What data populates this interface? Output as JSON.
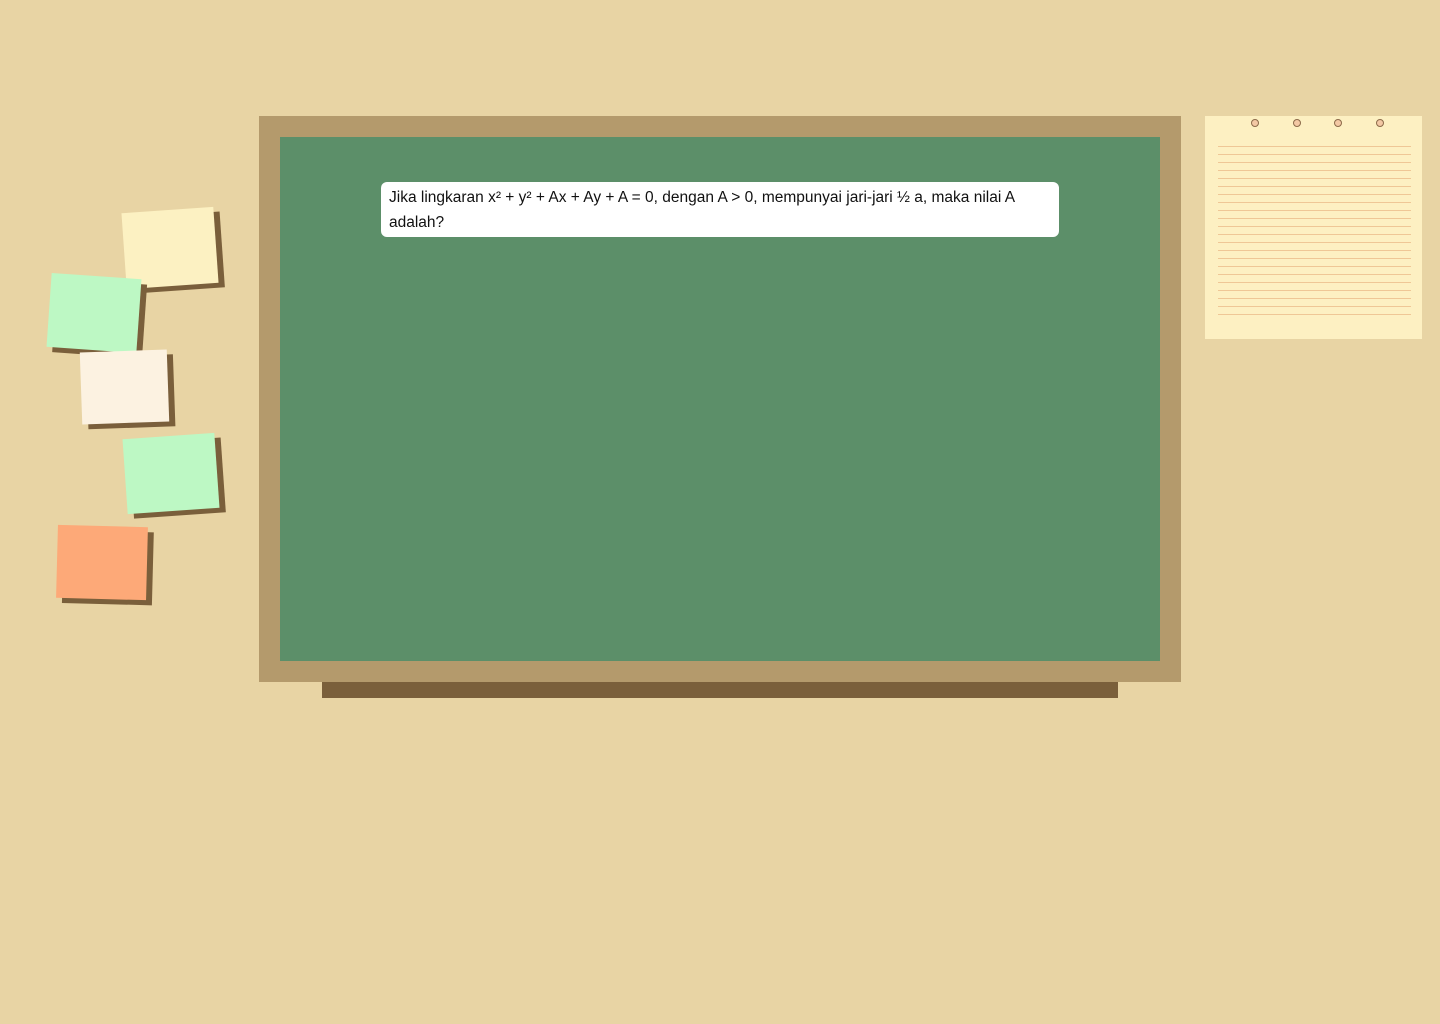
{
  "board": {
    "question": "Jika lingkaran x² + y² + Ax + Ay + A = 0, dengan A > 0, mempunyai jari-jari  ½ a, maka nilai A adalah?"
  },
  "sticky_notes": [
    {
      "color": "#fcf1c2"
    },
    {
      "color": "#bdf8c4"
    },
    {
      "color": "#fcf2e1"
    },
    {
      "color": "#bdf8c4"
    },
    {
      "color": "#fda978"
    }
  ],
  "colors": {
    "background": "#e8d4a4",
    "board_frame": "#b49a6c",
    "board_surface": "#5c8f69",
    "tray": "#7a5f3b",
    "notepad": "#fdf0c2"
  }
}
